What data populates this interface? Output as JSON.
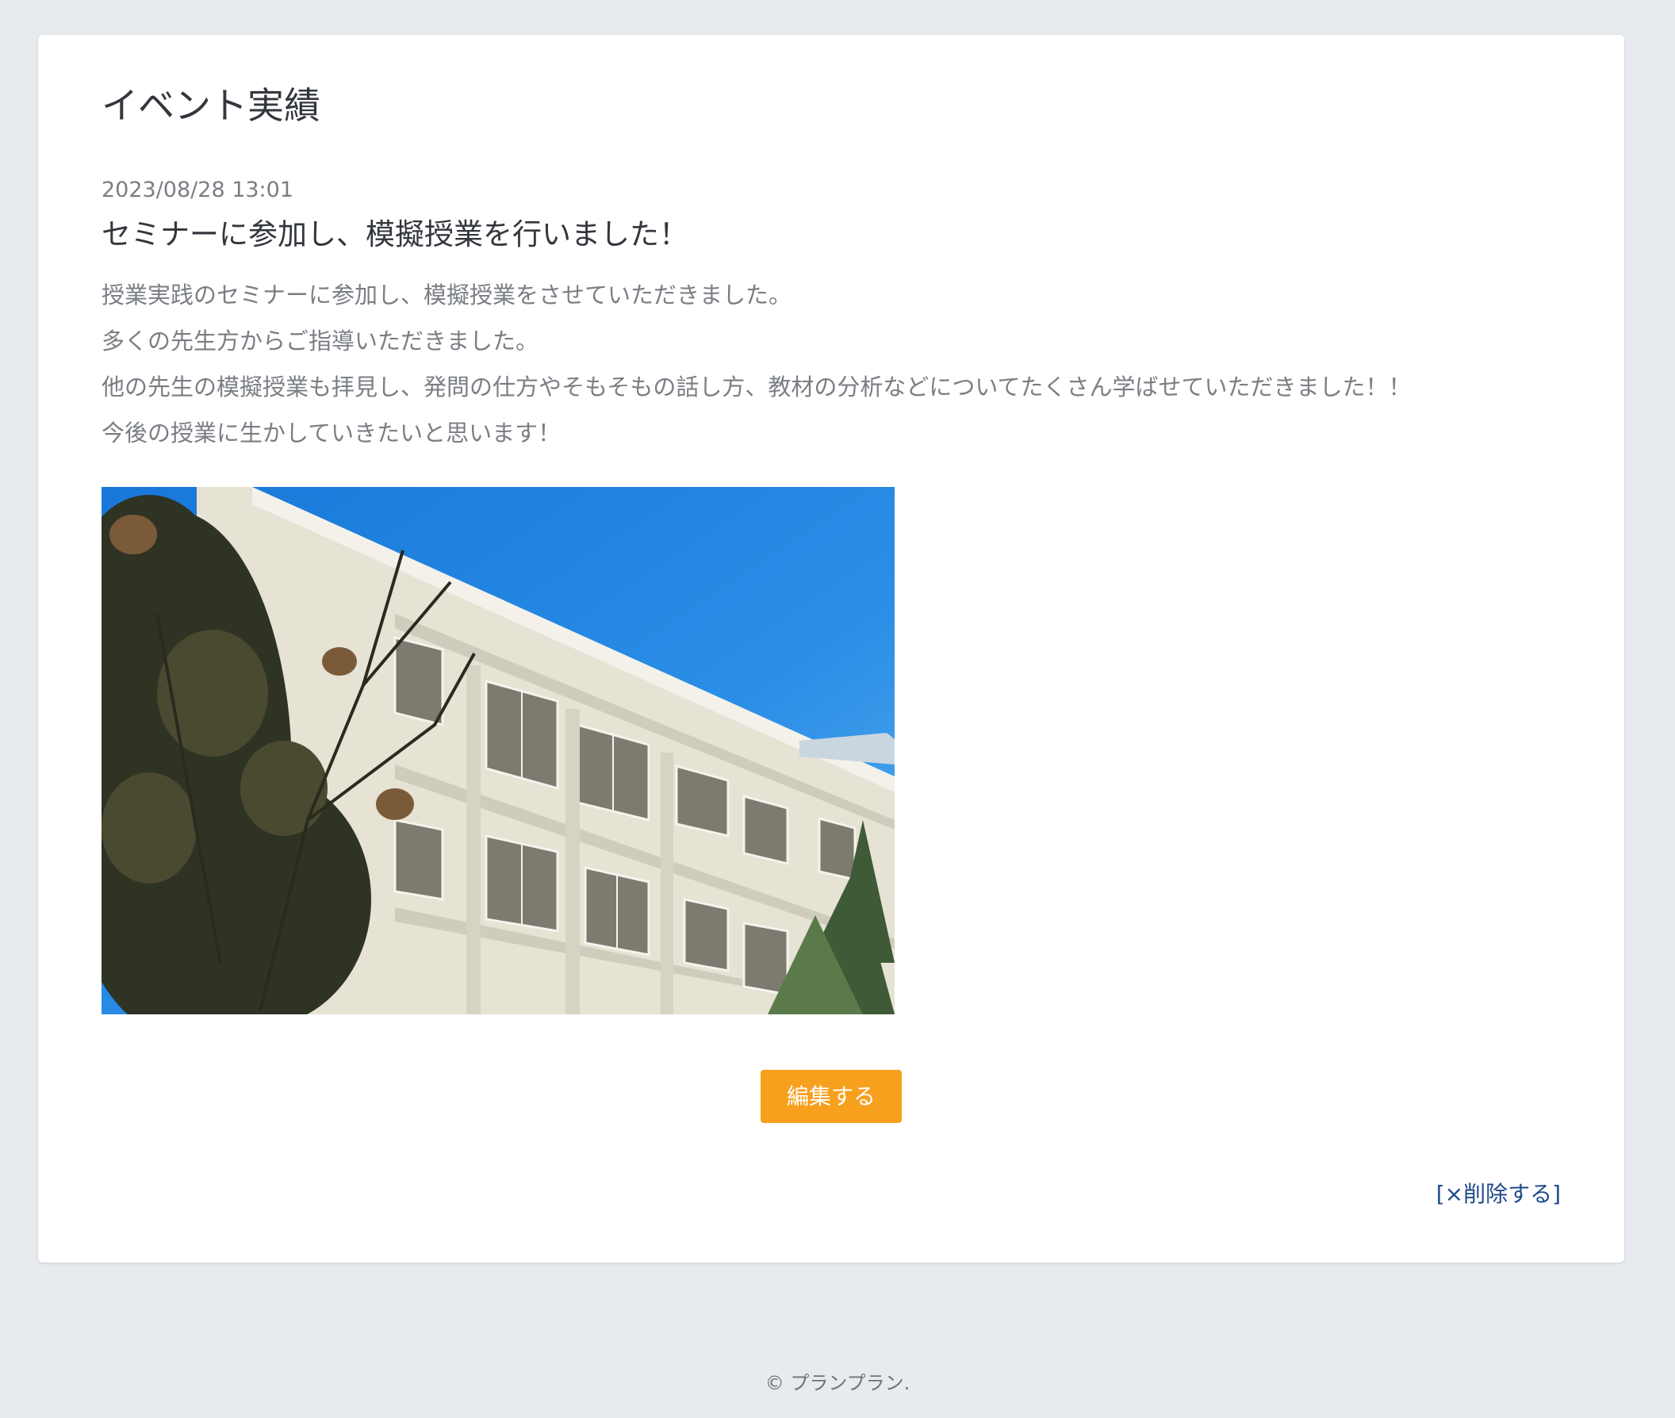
{
  "page": {
    "title": "イベント実績"
  },
  "post": {
    "date": "2023/08/28 13:01",
    "title": "セミナーに参加し、模擬授業を行いました！",
    "body_lines": [
      "授業実践のセミナーに参加し、模擬授業をさせていただきました。",
      "多くの先生方からご指導いただきました。",
      "他の先生の模擬授業も拝見し、発問の仕方やそもそもの話し方、教材の分析などについてたくさん学ばせていただきました！！",
      "今後の授業に生かしていきたいと思います！"
    ]
  },
  "actions": {
    "edit_label": "編集する",
    "delete_label": "[×削除する]"
  },
  "footer": {
    "copyright": "© プランプラン."
  },
  "colors": {
    "page_background": "#e7eaee",
    "card_background": "#ffffff",
    "edit_button": "#f7a01d",
    "delete_link": "#1f4a8a"
  }
}
